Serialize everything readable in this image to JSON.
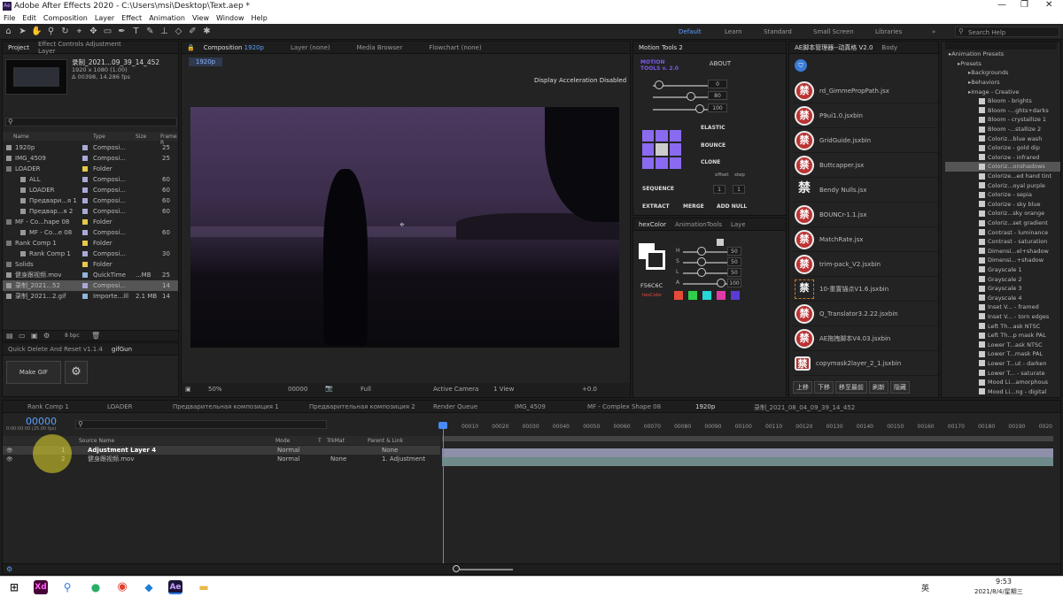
{
  "app": {
    "title": "Adobe After Effects 2020 - C:\\Users\\msi\\Desktop\\Text.aep *",
    "menus": [
      "File",
      "Edit",
      "Composition",
      "Layer",
      "Effect",
      "Animation",
      "View",
      "Window",
      "Help"
    ],
    "workspaces": [
      "Default",
      "Learn",
      "Standard",
      "Small Screen",
      "Libraries"
    ],
    "search_placeholder": "Search Help"
  },
  "project": {
    "tab": "Project",
    "tab2": "Effect Controls Adjustment Layer",
    "thumb_name": "录制_2021...09_39_14_452",
    "thumb_info1": "1920 x 1080 (1.00)",
    "thumb_info2": "Δ 00398, 14.286 fps",
    "cols": [
      "Name",
      "Type",
      "Size",
      "Frame R"
    ],
    "items": [
      {
        "name": "1920p",
        "type": "Composi...",
        "size": "",
        "fr": "25",
        "color": "#a9a9d8",
        "indent": 0
      },
      {
        "name": "IMG_4509",
        "type": "Composi...",
        "size": "",
        "fr": "25",
        "color": "#a9a9d8",
        "indent": 0
      },
      {
        "name": "LOADER",
        "type": "Folder",
        "size": "",
        "fr": "",
        "color": "#e8c84a",
        "indent": 0
      },
      {
        "name": "ALL",
        "type": "Composi...",
        "size": "",
        "fr": "60",
        "color": "#a9a9d8",
        "indent": 1
      },
      {
        "name": "LOADER",
        "type": "Composi...",
        "size": "",
        "fr": "60",
        "color": "#a9a9d8",
        "indent": 1
      },
      {
        "name": "Предвари...я 1",
        "type": "Composi...",
        "size": "",
        "fr": "60",
        "color": "#a9a9d8",
        "indent": 1
      },
      {
        "name": "Предвар...я 2",
        "type": "Composi...",
        "size": "",
        "fr": "60",
        "color": "#a9a9d8",
        "indent": 1
      },
      {
        "name": "MF - Co...hape 08",
        "type": "Folder",
        "size": "",
        "fr": "",
        "color": "#e8c84a",
        "indent": 0
      },
      {
        "name": "MF - Co...e 08",
        "type": "Composi...",
        "size": "",
        "fr": "60",
        "color": "#a9a9d8",
        "indent": 1
      },
      {
        "name": "Rank Comp 1",
        "type": "Folder",
        "size": "",
        "fr": "",
        "color": "#e8c84a",
        "indent": 0
      },
      {
        "name": "Rank Comp 1",
        "type": "Composi...",
        "size": "",
        "fr": "30",
        "color": "#a9a9d8",
        "indent": 1
      },
      {
        "name": "Solids",
        "type": "Folder",
        "size": "",
        "fr": "",
        "color": "#e8c84a",
        "indent": 0
      },
      {
        "name": "健身跟视频.mov",
        "type": "QuickTime",
        "size": "...MB",
        "fr": "25",
        "color": "#8fb3d9",
        "indent": 0
      },
      {
        "name": "录制_2021...52",
        "type": "Composi...",
        "size": "",
        "fr": "14",
        "color": "#a9a9d8",
        "indent": 0
      },
      {
        "name": "录制_2021...2.gif",
        "type": "Importe...ill",
        "size": "2.1 MB",
        "fr": "14",
        "color": "#8fb3d9",
        "indent": 0
      }
    ],
    "bpc": "8 bpc"
  },
  "quick": {
    "tab1": "Quick Delete And Reset v1.1.4",
    "tab2": "gifGun",
    "make_gif": "Make GIF"
  },
  "comp": {
    "tab": "Composition",
    "tab_name": "1920p",
    "tabs": [
      "Layer (none)",
      "Media Browser",
      "Flowchart (none)"
    ],
    "subtab": "1920p",
    "accel": "Display Acceleration Disabled",
    "zoom": "50%",
    "timecode": "00000",
    "res": "Full",
    "camera": "Active Camera",
    "view": "1 View",
    "offset": "+0.0"
  },
  "motion": {
    "tab": "Motion Tools 2",
    "logo": "MOTION TOOLS v. 2.0",
    "about": "ABOUT",
    "s1": "0",
    "s2": "80",
    "s3": "100",
    "elastic": "ELASTIC",
    "bounce": "BOUNCE",
    "clone": "CLONE",
    "offset": "offset",
    "step": "step",
    "sequence": "SEQUENCE",
    "v1": "1",
    "v2": "1",
    "extract": "EXTRACT",
    "merge": "MERGE",
    "addnull": "ADD NULL"
  },
  "hex": {
    "tab": "hexColor",
    "tab2": "AnimationTools",
    "tab3": "Layer",
    "h": "50",
    "s": "50",
    "l": "50",
    "a": "100",
    "hexval": "F56C6C",
    "brand": "hexColor",
    "swatches": [
      "#e84a3a",
      "#2fcf4a",
      "#27d6d6",
      "#e23ba8",
      "#5a3bd4"
    ]
  },
  "scripts": {
    "tab": "AE脚本管理器--动真格 V2.0",
    "tab2": "Body",
    "items": [
      "rd_GimmePropPath.jsx",
      "P9ui1.0.jsxbin",
      "GridGuide.jsxbin",
      "Buttcapper.jsx",
      "Bendy Nulls.jsx",
      "BOUNCr-1.1.jsx",
      "MatchRate.jsx",
      "trim-pack_V2.jsxbin",
      "10-重置锚点V1.6.jsxbin",
      "Q_Translator3.2.22.jsxbin",
      "AE拖拽脚本V4.03.jsxbin",
      "copymask2layer_2_1.jsxbin"
    ],
    "badge": "禁",
    "buttons": [
      "上移",
      "下移",
      "移至最前",
      "刷新",
      "隐藏"
    ]
  },
  "effects": {
    "search": "Search Help",
    "tree": [
      "Animation Presets",
      "Presets",
      "Backgrounds",
      "Behaviors",
      "Image - Creative"
    ],
    "presets": [
      "Bloom - brights",
      "Bloom -...ghts+darks",
      "Bloom - crystallize 1",
      "Bloom -...stallize 2",
      "Coloriz...blue wash",
      "Colorize - gold dip",
      "Colorize - infrared",
      "Coloriz...onshadows",
      "Colorize...ed hand tint",
      "Coloriz...oyal purple",
      "Colorize - sepia",
      "Colorize - sky blue",
      "Coloriz...sky orange",
      "Coloriz...set gradient",
      "Contrast - luminance",
      "Contrast - saturation",
      "Dimensi...el+shadow",
      "Dimensi...+shadow",
      "Grayscale 1",
      "Grayscale 2",
      "Grayscale 3",
      "Grayscale 4",
      "Inset V... - framed",
      "Inset V... - torn edges",
      "Left Th...ask NTSC",
      "Left Th...p mask PAL",
      "Lower T...ask NTSC",
      "Lower T...mask PAL",
      "Lower T...ut - darken",
      "Lower T... - saturate",
      "Mood Li...amorphous",
      "Mood Li...ng - digital"
    ]
  },
  "timeline": {
    "tabs": [
      "Rank Comp 1",
      "LOADER",
      "Предварительная композиция 1",
      "Предварительная композиция 2",
      "Render Queue",
      "IMG_4509",
      "MF - Complex Shape 08",
      "1920p",
      "录制_2021_08_04_09_39_14_452"
    ],
    "timecode": "00000",
    "tc_sub": "0:00:00:00 (25.00 fps)",
    "cols": [
      "Source Name",
      "Mode",
      "T",
      "TrkMat",
      "Parent & Link"
    ],
    "layers": [
      {
        "num": "1",
        "name": "Adjustment Layer 4",
        "mode": "Normal",
        "trk": "",
        "parent": "None"
      },
      {
        "num": "2",
        "name": "健身跟视频.mov",
        "mode": "Normal",
        "trk": "None",
        "parent": "1. Adjustment"
      }
    ],
    "ticks": [
      "00010",
      "00020",
      "00030",
      "00040",
      "00050",
      "00060",
      "00070",
      "00080",
      "00090",
      "00100",
      "00110",
      "00120",
      "00130",
      "00140",
      "00150",
      "00160",
      "00170",
      "00180",
      "00190",
      "0020"
    ]
  },
  "taskbar": {
    "time": "9:53",
    "date": "2021/8/4/星期三",
    "lang": "英"
  }
}
